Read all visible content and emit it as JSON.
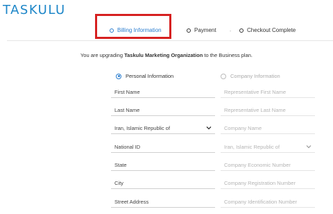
{
  "brand": {
    "logo_text": "TASKULU",
    "color": "#1d86c8"
  },
  "steps": [
    {
      "label": "Billing Information",
      "active": true
    },
    {
      "label": "Payment",
      "active": false
    },
    {
      "label": "Checkout Complete",
      "active": false
    }
  ],
  "steps_separator": "-",
  "intro": {
    "prefix": "You are upgrading ",
    "organization": "Taskulu Marketing Organization",
    "suffix": " to the Business plan."
  },
  "account_type": {
    "personal_label": "Personal Information",
    "company_label": "Company Information",
    "selected": "personal"
  },
  "personal_form": {
    "first_name_placeholder": "First Name",
    "last_name_placeholder": "Last Name",
    "country_value": "Iran, Islamic Republic of",
    "national_id_placeholder": "National ID",
    "state_placeholder": "State",
    "city_placeholder": "City",
    "street_placeholder": "Street Address"
  },
  "company_form": {
    "rep_first_name_placeholder": "Representative First Name",
    "rep_last_name_placeholder": "Representative Last Name",
    "company_name_placeholder": "Company Name",
    "country_value": "Iran, Islamic Republic of",
    "economic_number_placeholder": "Company Economic Number",
    "registration_number_placeholder": "Company Registration Number",
    "identification_number_placeholder": "Company Identification Number"
  },
  "colors": {
    "accent": "#2a7dcf",
    "highlight": "#d62020"
  }
}
